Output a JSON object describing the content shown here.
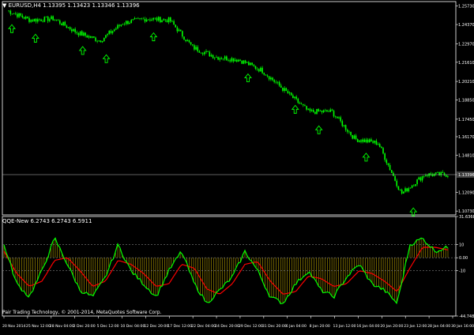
{
  "main_window": {
    "label": "▼ EURUSD,H4  1.13395 1.13423 1.13346 1.13396",
    "price_ticks": [
      "1.25730",
      "1.24370",
      "1.22970",
      "1.21610",
      "1.20210",
      "1.18850",
      "1.17450",
      "1.16170",
      "1.14810",
      "1.13396",
      "1.12090",
      "1.10730"
    ],
    "current_price": "1.13396"
  },
  "indicator_window": {
    "label": "QQE-New 6.2743 6.2743 6.5911",
    "y_ticks": [
      "31.6368",
      "10",
      "0.00",
      "-10",
      "-44.7485"
    ],
    "levels": [
      10,
      0,
      -10
    ]
  },
  "time_axis": {
    "labels": [
      "20 Nov 2014",
      "25 Nov 12:00",
      "28 Nov 04:00",
      "2 Dec 20:00",
      "5 Dec 12:00",
      "10 Dec 04:00",
      "12 Dec 20:00",
      "17 Dec 12:00",
      "22 Dec 04:00",
      "24 Dec 20:00",
      "29 Dec 12:00",
      "31 Dec 20:00",
      "6 Jan 04:00",
      "8 Jan 20:00",
      "13 Jan 12:00",
      "16 Jan 04:00",
      "20 Jan 20:00",
      "23 Jan 12:00",
      "28 Jan 04:00",
      "30 Jan 16:00"
    ]
  },
  "footer": {
    "copyright": "Pair Trading Technology, © 2001-2014, MetaQuotes Software Corp."
  },
  "colors": {
    "background": "#000000",
    "candles": "#00ff00",
    "up_arrow": "#00ff00",
    "down_marker": "#ff0000",
    "qqe_fast": "#00ff00",
    "qqe_slow": "#ff0000",
    "histogram": "#b8a000",
    "level_lines": "#808080",
    "axis": "#ffffff"
  },
  "chart_data": [
    {
      "type": "candlestick",
      "symbol": "EURUSD",
      "timeframe": "H4",
      "ohlc_current": {
        "open": 1.13395,
        "high": 1.13423,
        "low": 1.13346,
        "close": 1.13396
      },
      "x_range": [
        "20 Nov 2014",
        "30 Jan 16:00"
      ],
      "ylim": [
        1.1045,
        1.2605
      ],
      "close_path": [
        [
          "20 Nov 2014",
          1.254
        ],
        [
          "25 Nov 12:00",
          1.247
        ],
        [
          "28 Nov 04:00",
          1.248
        ],
        [
          "2 Dec 20:00",
          1.238
        ],
        [
          "5 Dec 12:00",
          1.232
        ],
        [
          "10 Dec 04:00",
          1.245
        ],
        [
          "12 Dec 20:00",
          1.248
        ],
        [
          "17 Dec 12:00",
          1.247
        ],
        [
          "22 Dec 04:00",
          1.227
        ],
        [
          "24 Dec 20:00",
          1.22
        ],
        [
          "29 Dec 12:00",
          1.218
        ],
        [
          "31 Dec 20:00",
          1.21
        ],
        [
          "6 Jan 04:00",
          1.195
        ],
        [
          "8 Jan 20:00",
          1.18
        ],
        [
          "13 Jan 12:00",
          1.18
        ],
        [
          "16 Jan 04:00",
          1.16
        ],
        [
          "20 Jan 20:00",
          1.157
        ],
        [
          "23 Jan 12:00",
          1.12
        ],
        [
          "28 Jan 04:00",
          1.134
        ],
        [
          "30 Jan 16:00",
          1.134
        ]
      ],
      "up_arrows_at": [
        "20 Nov 2014",
        "25 Nov 12:00",
        "2 Dec 20:00",
        "5 Dec 12:00",
        "12 Dec 20:00",
        "29 Dec 12:00",
        "6 Jan 04:00",
        "8 Jan 20:00",
        "16 Jan 04:00",
        "23 Jan 12:00"
      ]
    },
    {
      "type": "line",
      "title": "QQE-New 6.2743 6.2743 6.5911",
      "ylim": [
        -44.7485,
        31.6368
      ],
      "levels": [
        10,
        0,
        -10
      ],
      "series": [
        {
          "values": [
            10,
            -20,
            -30,
            -10,
            15,
            -5,
            -25,
            -30,
            -15,
            10,
            -10,
            -20,
            -30,
            -10,
            5,
            -20,
            -35,
            -25,
            -15,
            5,
            -10,
            -30,
            -35,
            -20,
            -10,
            -25,
            -30,
            -15,
            -5,
            -20,
            -25,
            -35,
            10,
            15,
            5,
            8
          ]
        },
        {
          "values": [
            5,
            -12,
            -22,
            -18,
            -2,
            0,
            -10,
            -22,
            -18,
            -2,
            -5,
            -12,
            -22,
            -20,
            -5,
            -8,
            -24,
            -28,
            -20,
            -5,
            -3,
            -18,
            -28,
            -26,
            -14,
            -16,
            -22,
            -20,
            -10,
            -12,
            -18,
            -26,
            -8,
            8,
            8,
            6
          ]
        }
      ]
    }
  ]
}
